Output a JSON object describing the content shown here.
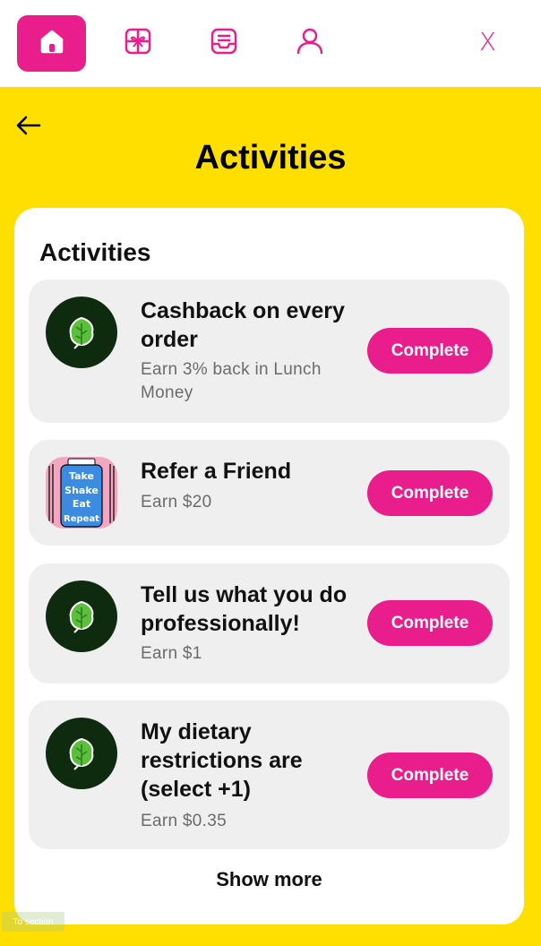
{
  "nav": {
    "items": [
      {
        "icon": "home-icon",
        "active": true
      },
      {
        "icon": "gift-icon",
        "active": false
      },
      {
        "icon": "inbox-icon",
        "active": false
      },
      {
        "icon": "user-icon",
        "active": false
      }
    ],
    "close_label": "X"
  },
  "header": {
    "back_icon": "arrow-left-icon",
    "title": "Activities"
  },
  "section": {
    "title": "Activities",
    "activities": [
      {
        "title": "Cashback on every order",
        "subtitle": "Earn 3% back in Lunch Money",
        "button": "Complete",
        "image": "spinach-leaf-icon"
      },
      {
        "title": "Refer a Friend",
        "subtitle": "Earn $20",
        "button": "Complete",
        "image": "jar-sticker",
        "image_text": "Take Shake Eat Repeat"
      },
      {
        "title": "Tell us what you do professionally!",
        "subtitle": "Earn $1",
        "button": "Complete",
        "image": "spinach-leaf-icon"
      },
      {
        "title": "My dietary restrictions are (select +1)",
        "subtitle": "Earn $0.35",
        "button": "Complete",
        "image": "spinach-leaf-icon"
      }
    ],
    "show_more": "Show more"
  },
  "footer": {
    "to_section": "To section"
  },
  "colors": {
    "accent": "#E91E8C",
    "background": "#FFDF00",
    "card": "#FFFFFF",
    "item_bg": "#EFEFEF",
    "avatar_bg": "#0E2A0F"
  }
}
